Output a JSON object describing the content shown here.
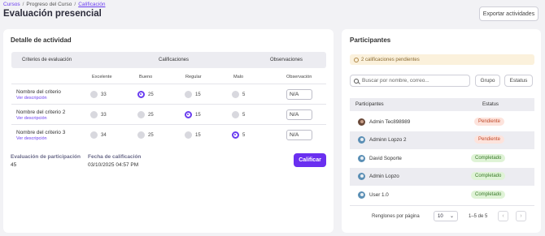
{
  "breadcrumb": {
    "items": [
      "Cursos",
      "Progreso del Curso",
      "Calificación"
    ]
  },
  "page_title": "Evaluación presencial",
  "export_button": "Exportar actividades",
  "activity": {
    "title": "Detalle de actividad",
    "headers": {
      "criteria": "Criterios de evaluación",
      "grades": "Calificaciones",
      "observations": "Observaciones"
    },
    "subheaders": {
      "excelente": "Excelente",
      "bueno": "Bueno",
      "regular": "Regular",
      "malo": "Malo",
      "observacion": "Observación"
    },
    "criteria": [
      {
        "name": "Nombre del criterio",
        "link": "Ver descripción",
        "values": [
          "33",
          "25",
          "15",
          "5"
        ],
        "selected": 1,
        "obs": "N/A"
      },
      {
        "name": "Nombre del criterio 2",
        "link": "Ver descripción",
        "values": [
          "33",
          "25",
          "15",
          "5"
        ],
        "selected": 2,
        "obs": "N/A"
      },
      {
        "name": "Nombre del criterio 3",
        "link": "Ver descripción",
        "values": [
          "34",
          "25",
          "15",
          "5"
        ],
        "selected": 3,
        "obs": "N/A"
      }
    ],
    "participation_label": "Evaluación de participación",
    "participation_value": "45",
    "date_label": "Fecha de calificación",
    "date_value": "03/10/2025 04:57 PM",
    "grade_button": "Calificar"
  },
  "participants": {
    "title": "Participantes",
    "notice": "2 calificaciones pendientes",
    "search_placeholder": "Buscar por nombre, correo...",
    "group_button": "Grupo",
    "status_button": "Estatus",
    "col_participants": "Participantes",
    "col_status": "Estatus",
    "rows": [
      {
        "name": "Admin Tec898989",
        "status": "Pendiente",
        "state": "pending",
        "avatar": "photo"
      },
      {
        "name": "Adminn Lopzo 2",
        "status": "Pendiente",
        "state": "pending",
        "avatar": "default"
      },
      {
        "name": "David Soporte",
        "status": "Completado",
        "state": "done",
        "avatar": "default"
      },
      {
        "name": "Admin Lopzo",
        "status": "Completado",
        "state": "done",
        "avatar": "default"
      },
      {
        "name": "User 1.0",
        "status": "Completado",
        "state": "done",
        "avatar": "default"
      }
    ],
    "rows_per_page_label": "Renglones por página",
    "rows_per_page": "10",
    "range": "1–5 de 5"
  },
  "colors": {
    "accent": "#6a2ff0",
    "pending_bg": "#fde3dc",
    "done_bg": "#dff3d6"
  }
}
